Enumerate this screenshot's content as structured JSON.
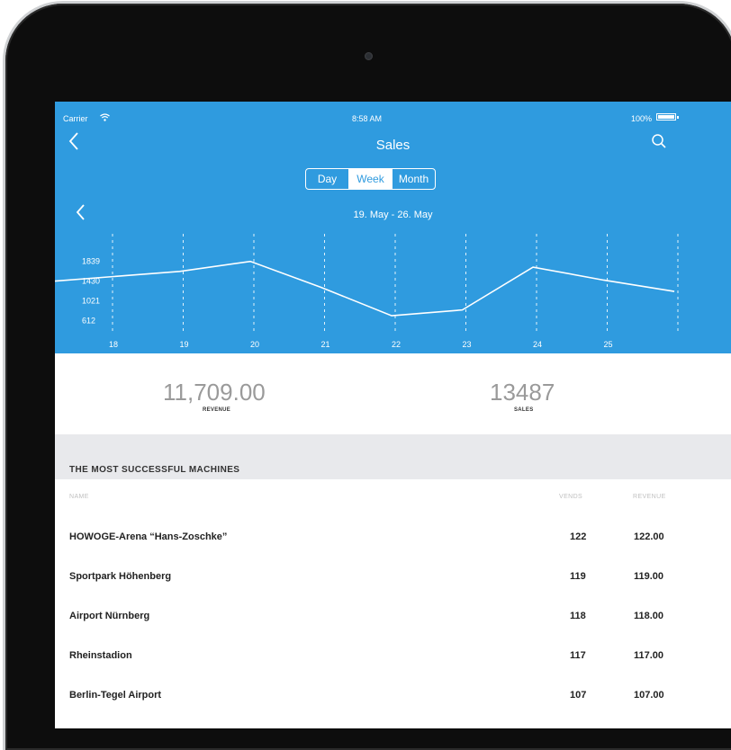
{
  "status_bar": {
    "carrier": "Carrier",
    "time": "8:58 AM",
    "battery": "100%",
    "battery_level": 1.0
  },
  "nav": {
    "title": "Sales"
  },
  "segment": {
    "options": [
      "Day",
      "Week",
      "Month"
    ],
    "selected": "Week"
  },
  "date_range": "19. May - 26. May",
  "chart_data": {
    "type": "line",
    "x": [
      18,
      19,
      20,
      21,
      22,
      23,
      24,
      25
    ],
    "categories": [
      "18",
      "19",
      "20",
      "21",
      "22",
      "23",
      "24",
      "25"
    ],
    "y_ticks": [
      "1839",
      "1430",
      "1021",
      "612"
    ],
    "series": [
      {
        "values": [
          1430,
          1630,
          1839,
          1300,
          710,
          830,
          1720,
          1450,
          1215
        ]
      }
    ],
    "ylim": [
      300,
      2300
    ],
    "grid": "vertical-dashed"
  },
  "kpis": {
    "revenue": {
      "value": "11,709.00",
      "label": "REVENUE"
    },
    "sales": {
      "value": "13487",
      "label": "SALES"
    }
  },
  "section": {
    "title": "THE MOST SUCCESSFUL MACHINES"
  },
  "table": {
    "headers": {
      "name": "NAME",
      "vends": "VENDS",
      "revenue": "REVENUE"
    },
    "rows": [
      {
        "name": "HOWOGE-Arena “Hans-Zoschke”",
        "vends": "122",
        "revenue": "122.00"
      },
      {
        "name": "Sportpark Höhenberg",
        "vends": "119",
        "revenue": "119.00"
      },
      {
        "name": "Airport Nürnberg",
        "vends": "118",
        "revenue": "118.00"
      },
      {
        "name": "Rheinstadion",
        "vends": "117",
        "revenue": "117.00"
      },
      {
        "name": "Berlin-Tegel Airport",
        "vends": "107",
        "revenue": "107.00"
      }
    ]
  },
  "colors": {
    "accent": "#2f9bdf",
    "bezel": "#0d0d0d",
    "band": "#e8e9ec"
  }
}
